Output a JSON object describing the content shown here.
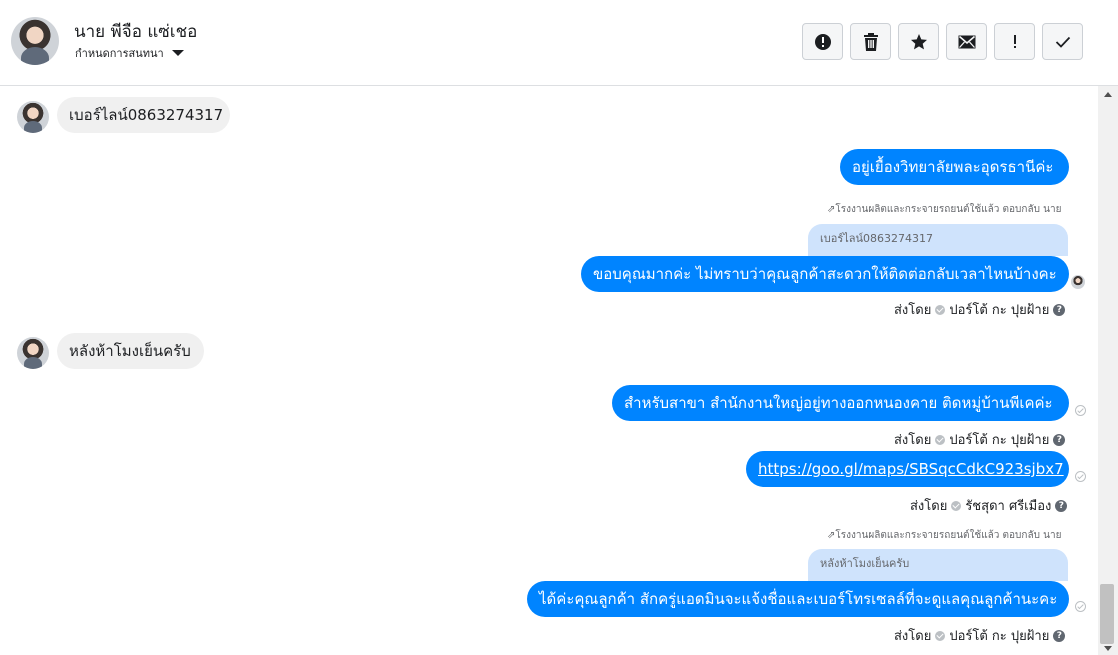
{
  "header": {
    "contact_name": "นาย พีจือ แซ่เชอ",
    "assign_label": "กำหนดการสนทนา",
    "toolbar": [
      {
        "name": "alert-icon"
      },
      {
        "name": "trash-icon"
      },
      {
        "name": "star-icon"
      },
      {
        "name": "envelope-icon"
      },
      {
        "name": "exclamation-icon"
      },
      {
        "name": "checkmark-icon"
      }
    ]
  },
  "messages": {
    "m1": {
      "text": "เบอร์ไลน์0863274317"
    },
    "m2": {
      "text": "อยู่เยื้องวิทยาลัยพละอุดรธานีค่ะ"
    },
    "m3": {
      "reply_meta": "โรงงานผลิตและกระจายรถยนต์ใช้แล้ว ตอบกลับ นาย",
      "quote": "เบอร์ไลน์0863274317",
      "text": "ขอบคุณมากค่ะ ไม่ทราบว่าคุณลูกค้าสะดวกให้ติดต่อกลับเวลาไหนบ้างคะ",
      "sent_prefix": "ส่งโดย",
      "sent_by": "ปอร์โต้ กะ ปุยฝ้าย"
    },
    "m4": {
      "text": "หลังห้าโมงเย็นครับ"
    },
    "m5": {
      "text": "สำหรับสาขา สำนักงานใหญ่อยู่ทางออกหนองคาย ติดหมู่บ้านพีเคค่ะ",
      "sent_prefix": "ส่งโดย",
      "sent_by": "ปอร์โต้ กะ ปุยฝ้าย"
    },
    "m6": {
      "link": "https://goo.gl/maps/SBSqcCdkC923sjbx7",
      "sent_prefix": "ส่งโดย",
      "sent_by": "รัชสุดา ศรีเมือง"
    },
    "m7": {
      "reply_meta": "โรงงานผลิตและกระจายรถยนต์ใช้แล้ว ตอบกลับ นาย",
      "quote": "หลังห้าโมงเย็นครับ",
      "text": "ได้ค่ะคุณลูกค้า สักครู่แอดมินจะแจ้งชื่อและเบอร์โทรเซลล์ที่จะดูแลคุณลูกค้านะคะ",
      "sent_prefix": "ส่งโดย",
      "sent_by": "ปอร์โต้ กะ ปุยฝ้าย"
    }
  },
  "colors": {
    "outgoing_bubble": "#0084ff",
    "incoming_bubble": "#f0f0f0",
    "quote_bubble": "#cfe3fc"
  }
}
